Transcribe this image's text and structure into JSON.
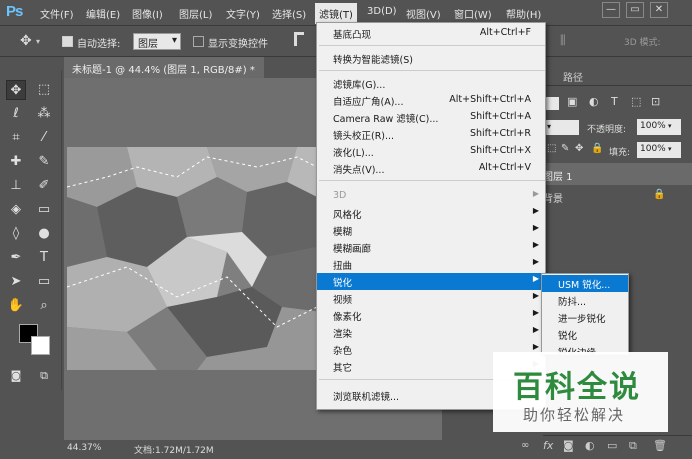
{
  "app": {
    "logo": "Ps"
  },
  "menubar": {
    "items": [
      "文件(F)",
      "编辑(E)",
      "图像(I)",
      "图层(L)",
      "文字(Y)",
      "选择(S)",
      "滤镜(T)",
      "3D(D)",
      "视图(V)",
      "窗口(W)",
      "帮助(H)"
    ],
    "active": "滤镜(T)"
  },
  "window_controls": {
    "minimize": "—",
    "restore": "▭",
    "close": "✕"
  },
  "options_bar": {
    "auto_select_label": "自动选择:",
    "auto_select_value": "图层",
    "show_transform_label": "显示变换控件",
    "mode_label": "3D 模式:"
  },
  "document": {
    "tab_title": "未标题-1 @ 44.4% (图层 1, RGB/8#) *",
    "close_glyph": "×",
    "zoom": "44.37%",
    "doc_info": "文档:1.72M/1.72M"
  },
  "filter_menu": {
    "items": [
      {
        "label": "基底凸现",
        "shortcut": "Alt+Ctrl+F"
      },
      {
        "label": "转换为智能滤镜(S)",
        "shortcut": ""
      },
      {
        "label": "滤镜库(G)...",
        "shortcut": ""
      },
      {
        "label": "自适应广角(A)...",
        "shortcut": "Alt+Shift+Ctrl+A"
      },
      {
        "label": "Camera Raw 滤镜(C)...",
        "shortcut": "Shift+Ctrl+A"
      },
      {
        "label": "镜头校正(R)...",
        "shortcut": "Shift+Ctrl+R"
      },
      {
        "label": "液化(L)...",
        "shortcut": "Shift+Ctrl+X"
      },
      {
        "label": "消失点(V)...",
        "shortcut": "Alt+Ctrl+V"
      },
      {
        "label": "3D",
        "shortcut": ""
      },
      {
        "label": "风格化",
        "shortcut": ""
      },
      {
        "label": "模糊",
        "shortcut": ""
      },
      {
        "label": "模糊画廊",
        "shortcut": ""
      },
      {
        "label": "扭曲",
        "shortcut": ""
      },
      {
        "label": "锐化",
        "shortcut": ""
      },
      {
        "label": "视频",
        "shortcut": ""
      },
      {
        "label": "像素化",
        "shortcut": ""
      },
      {
        "label": "渲染",
        "shortcut": ""
      },
      {
        "label": "杂色",
        "shortcut": ""
      },
      {
        "label": "其它",
        "shortcut": ""
      },
      {
        "label": "浏览联机滤镜...",
        "shortcut": ""
      }
    ]
  },
  "sharpen_submenu": {
    "items": [
      "USM 锐化...",
      "防抖...",
      "进一步锐化",
      "锐化",
      "锐化边缘"
    ]
  },
  "layers_panel": {
    "tab_paths": "路径",
    "opacity_label": "不透明度:",
    "opacity_value": "100%",
    "fill_label": "填充:",
    "fill_value": "100%",
    "layers": [
      "图层 1",
      "背景"
    ]
  },
  "watermark": {
    "title": "百科全说",
    "subtitle": "助你轻松解决"
  },
  "colors": {
    "highlight": "#0a79d1",
    "brand": "#2e8a3c"
  }
}
